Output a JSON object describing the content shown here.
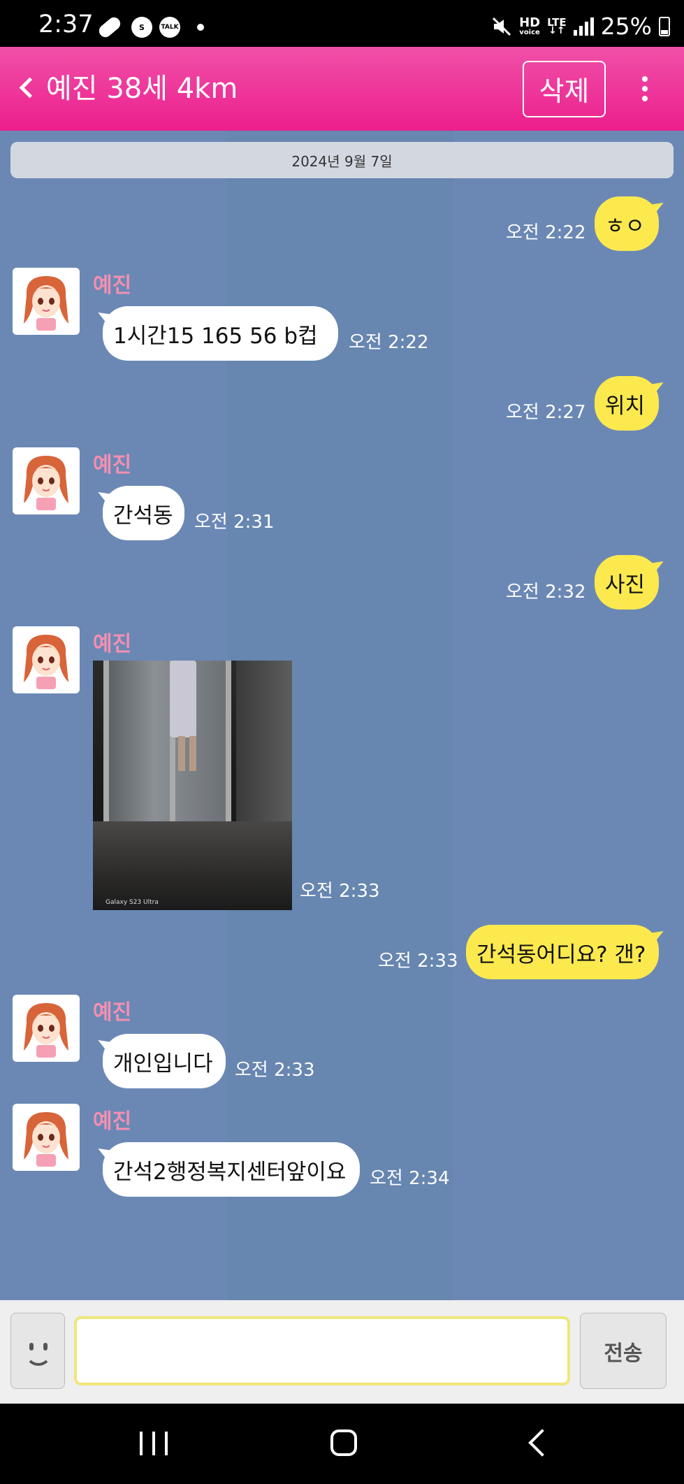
{
  "status_bar": {
    "time": "2:37",
    "skype_label": "S",
    "talk_label": "TALK",
    "hd_label": "HD",
    "voice_label": "voice",
    "lte_label": "LTE",
    "battery": "25%"
  },
  "header": {
    "title": "예진 38세 4km",
    "delete_label": "삭제"
  },
  "chat": {
    "date": "2024년 9월 7일",
    "messages": [
      {
        "from": "me",
        "text": "ㅎㅇ",
        "time": "오전 2:22"
      },
      {
        "from": "them",
        "sender": "예진",
        "text": "1시간15  165  56  b컵",
        "time": "오전 2:22"
      },
      {
        "from": "me",
        "text": "위치",
        "time": "오전 2:27"
      },
      {
        "from": "them",
        "sender": "예진",
        "text": "간석동",
        "time": "오전 2:31"
      },
      {
        "from": "me",
        "text": "사진",
        "time": "오전 2:32"
      },
      {
        "from": "them",
        "sender": "예진",
        "type": "image",
        "caption": "Galaxy S23 Ultra",
        "time": "오전 2:33"
      },
      {
        "from": "me",
        "text": "간석동어디요? 갠?",
        "time": "오전 2:33"
      },
      {
        "from": "them",
        "sender": "예진",
        "text": "개인입니다",
        "time": "오전 2:33"
      },
      {
        "from": "them",
        "sender": "예진",
        "text": "간석2행정복지센터앞이요",
        "time": "오전 2:34"
      }
    ]
  },
  "input_bar": {
    "placeholder": "",
    "send_label": "전송"
  },
  "colors": {
    "header_pink": "#ec1f8d",
    "chat_bg": "#6b88b5",
    "my_bubble": "#fbe94e",
    "their_bubble": "#ffffff",
    "sender_name": "#f48fb1"
  }
}
